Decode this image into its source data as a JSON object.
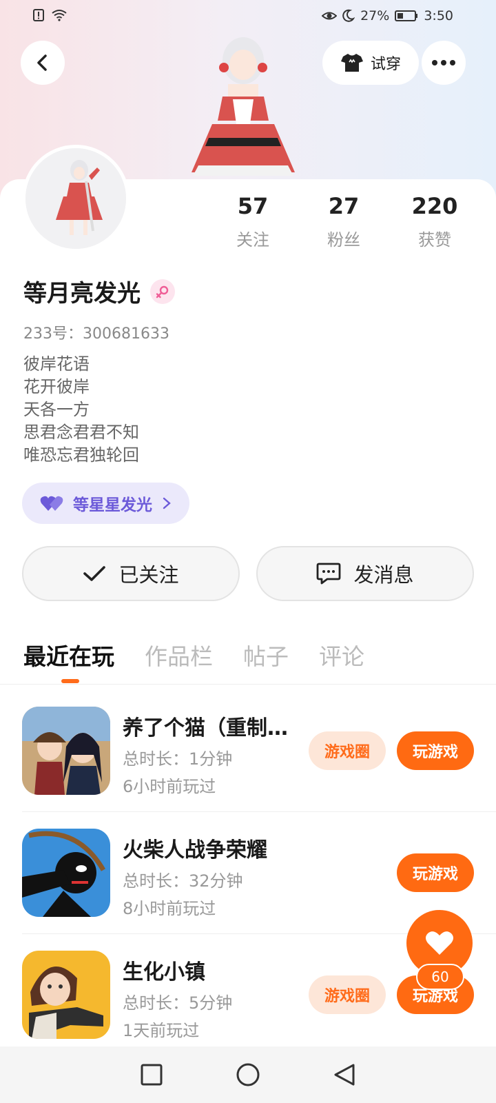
{
  "status_bar": {
    "battery": "27%",
    "time": "3:50"
  },
  "header": {
    "try_on_label": "试穿"
  },
  "stats": [
    {
      "value": "57",
      "label": "关注"
    },
    {
      "value": "27",
      "label": "粉丝"
    },
    {
      "value": "220",
      "label": "获赞"
    }
  ],
  "profile": {
    "name": "等月亮发光",
    "uid_label": "233号：",
    "uid": "300681633",
    "bio": [
      "彼岸花语",
      "花开彼岸",
      "天各一方",
      "思君念君君不知",
      "唯恐忘君独轮回"
    ],
    "group_label": "等星星发光",
    "gender_color": "#ef5d96"
  },
  "actions": {
    "followed_label": "已关注",
    "message_label": "发消息"
  },
  "tabs": [
    {
      "label": "最近在玩",
      "active": true
    },
    {
      "label": "作品栏",
      "active": false
    },
    {
      "label": "帖子",
      "active": false
    },
    {
      "label": "评论",
      "active": false
    }
  ],
  "games": [
    {
      "title": "养了个猫（重制…",
      "duration": "总时长：1分钟",
      "last_played": "6小时前玩过",
      "has_circle": true,
      "circle_label": "游戏圈",
      "play_label": "玩游戏"
    },
    {
      "title": "火柴人战争荣耀",
      "duration": "总时长：32分钟",
      "last_played": "8小时前玩过",
      "has_circle": false,
      "play_label": "玩游戏"
    },
    {
      "title": "生化小镇",
      "duration": "总时长：5分钟",
      "last_played": "1天前玩过",
      "has_circle": true,
      "circle_label": "游戏圈",
      "play_label": "玩游戏"
    }
  ],
  "like_fab": {
    "count": "60"
  },
  "colors": {
    "accent": "#ff6a12",
    "group_purple": "#6c5ad9"
  }
}
